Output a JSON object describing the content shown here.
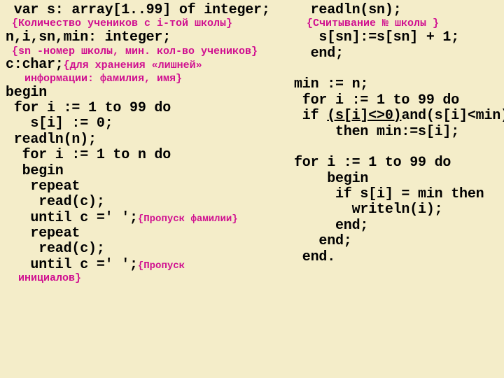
{
  "left": {
    "l1": " var s: array[1..99] of integer;",
    "c1": " {Количество учеников с i-той школы}",
    "l2": "n,i,sn,min: integer;",
    "c2": " {sn -номер школы, мин. кол-во учеников}",
    "l3a": "c:char;",
    "c3a": "{для хранения «лишней»",
    "c3b": "   информации: фамилия, имя}",
    "l4": "begin",
    "l5": " for i := 1 to 99 do",
    "l6": "   s[i] := 0;",
    "l7": " readln(n);",
    "l8": "  for i := 1 to n do",
    "l9": "  begin",
    "l10": "   repeat",
    "l11": "    read(c);",
    "l12a": "   until c =' ';",
    "c12": "{Пропуск фамилии}",
    "l13": "   repeat",
    "l14": "    read(c);",
    "l15a": "   until c =' ';",
    "c15": "{Пропуск",
    "c16": "  инициалов}"
  },
  "right": {
    "r1": "  readln(sn);",
    "rc1": "  {Считывание № школы }",
    "r2": "   s[sn]:=s[sn] + 1;",
    "r3": "  end;",
    "blank1": " ",
    "r4": "min := n;",
    "r5": " for i := 1 to 99 do",
    "r6a": " if ",
    "r6b": "(s[i]<>0)",
    "r6c": "and(s[i]<min)",
    "r7": "     then min:=s[i];",
    "blank2": " ",
    "r8": "for i := 1 to 99 do",
    "r9": "    begin",
    "r10": "     if s[i] = min then",
    "r11": "       writeln(i);",
    "r12": "     end;",
    "r13": "   end;",
    "r14": " end."
  }
}
